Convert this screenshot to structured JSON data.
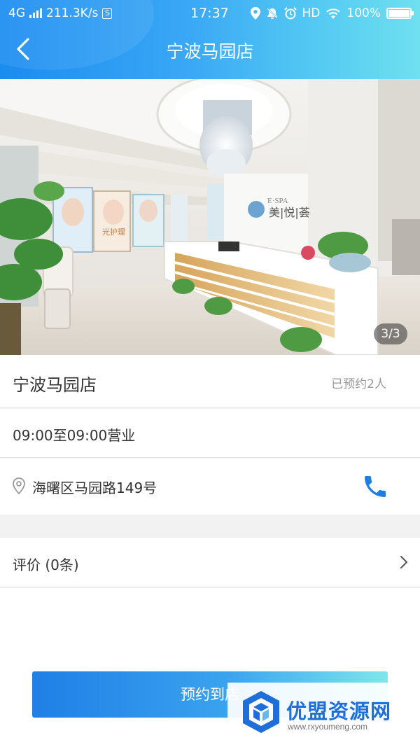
{
  "status_bar": {
    "network": "4G",
    "speed": "211.3K/s",
    "s_badge": "S",
    "time": "17:37",
    "hd": "HD",
    "battery": "100%",
    "battery_level": 1.0
  },
  "nav": {
    "title": "宁波马园店"
  },
  "gallery": {
    "counter": "3/3",
    "current": 3,
    "total": 3,
    "sign_text": "E·SPA",
    "sign_brand": "美|悦|荟",
    "poster_text": "光护理"
  },
  "store": {
    "name": "宁波马园店",
    "booked": "已预约2人",
    "hours": "09:00至09:00营业",
    "address": "海曙区马园路149号"
  },
  "review": {
    "label": "评价 (0条)"
  },
  "cta": {
    "label": "预约到店"
  },
  "watermark": {
    "title": "优盟资源网",
    "url": "www.rxyoumeng.com"
  },
  "colors": {
    "header_start": "#1a8cf0",
    "header_end": "#6fe0ef",
    "phone_icon": "#1e7fe0",
    "watermark": "#1e6fd9"
  }
}
